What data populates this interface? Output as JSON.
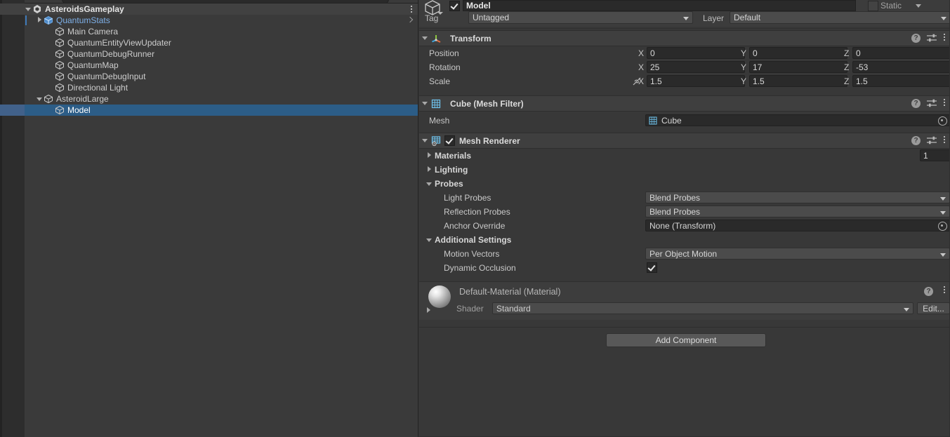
{
  "hierarchy": {
    "search_placeholder": "",
    "rows": [
      {
        "label": "AsteroidsGameplay",
        "depth": 0,
        "icon": "unity-scene-icon",
        "foldout": "down",
        "kind": "root",
        "selected": false,
        "kebab": true
      },
      {
        "label": "QuantumStats",
        "depth": 1,
        "icon": "prefab-cube-icon",
        "foldout": "right",
        "kind": "prefab",
        "selected": false,
        "chevron": true,
        "marker": true
      },
      {
        "label": "Main Camera",
        "depth": 2,
        "icon": "gameobject-cube-icon",
        "foldout": "none",
        "kind": "normal",
        "selected": false
      },
      {
        "label": "QuantumEntityViewUpdater",
        "depth": 2,
        "icon": "gameobject-cube-icon",
        "foldout": "none",
        "kind": "normal",
        "selected": false
      },
      {
        "label": "QuantumDebugRunner",
        "depth": 2,
        "icon": "gameobject-cube-icon",
        "foldout": "none",
        "kind": "normal",
        "selected": false
      },
      {
        "label": "QuantumMap",
        "depth": 2,
        "icon": "gameobject-cube-icon",
        "foldout": "none",
        "kind": "normal",
        "selected": false
      },
      {
        "label": "QuantumDebugInput",
        "depth": 2,
        "icon": "gameobject-cube-icon",
        "foldout": "none",
        "kind": "normal",
        "selected": false
      },
      {
        "label": "Directional Light",
        "depth": 2,
        "icon": "gameobject-cube-icon",
        "foldout": "none",
        "kind": "normal",
        "selected": false
      },
      {
        "label": "AsteroidLarge",
        "depth": 1,
        "icon": "gameobject-cube-icon",
        "foldout": "down",
        "kind": "normal",
        "selected": false
      },
      {
        "label": "Model",
        "depth": 2,
        "icon": "gameobject-cube-icon",
        "foldout": "none",
        "kind": "normal",
        "selected": true
      }
    ]
  },
  "inspector": {
    "gameobject": {
      "name": "Model",
      "enabled": true,
      "static_label": "Static",
      "static_checked": false,
      "tag_label": "Tag",
      "tag_value": "Untagged",
      "layer_label": "Layer",
      "layer_value": "Default"
    },
    "transform": {
      "title": "Transform",
      "rows": [
        {
          "label": "Position",
          "x": "0",
          "y": "0",
          "z": "0"
        },
        {
          "label": "Rotation",
          "x": "25",
          "y": "17",
          "z": "-53"
        },
        {
          "label": "Scale",
          "x": "1.5",
          "y": "1.5",
          "z": "1.5"
        }
      ],
      "axis_labels": {
        "x": "X",
        "y": "Y",
        "z": "Z"
      }
    },
    "mesh_filter": {
      "title": "Cube (Mesh Filter)",
      "mesh_label": "Mesh",
      "mesh_value": "Cube"
    },
    "mesh_renderer": {
      "title": "Mesh Renderer",
      "enabled": true,
      "materials_label": "Materials",
      "materials_count": "1",
      "lighting_label": "Lighting",
      "probes_label": "Probes",
      "light_probes_label": "Light Probes",
      "light_probes_value": "Blend Probes",
      "reflection_probes_label": "Reflection Probes",
      "reflection_probes_value": "Blend Probes",
      "anchor_override_label": "Anchor Override",
      "anchor_override_value": "None (Transform)",
      "additional_settings_label": "Additional Settings",
      "motion_vectors_label": "Motion Vectors",
      "motion_vectors_value": "Per Object Motion",
      "dynamic_occlusion_label": "Dynamic Occlusion",
      "dynamic_occlusion_checked": true
    },
    "material": {
      "title": "Default-Material (Material)",
      "shader_label": "Shader",
      "shader_value": "Standard",
      "edit_label": "Edit..."
    },
    "add_component_label": "Add Component",
    "help_glyph": "?"
  },
  "colors": {
    "panel_bg": "#383838",
    "hierarchy_bg": "#3a3a3a",
    "gutter_bg": "#2d2d2d",
    "component_header_bg": "#3f3f3f",
    "selection_blue": "#2c5d87",
    "prefab_blue": "#7eb0e8",
    "field_bg": "#2a2a2a",
    "dropdown_bg": "#4b4b4b",
    "button_bg": "#585858"
  }
}
